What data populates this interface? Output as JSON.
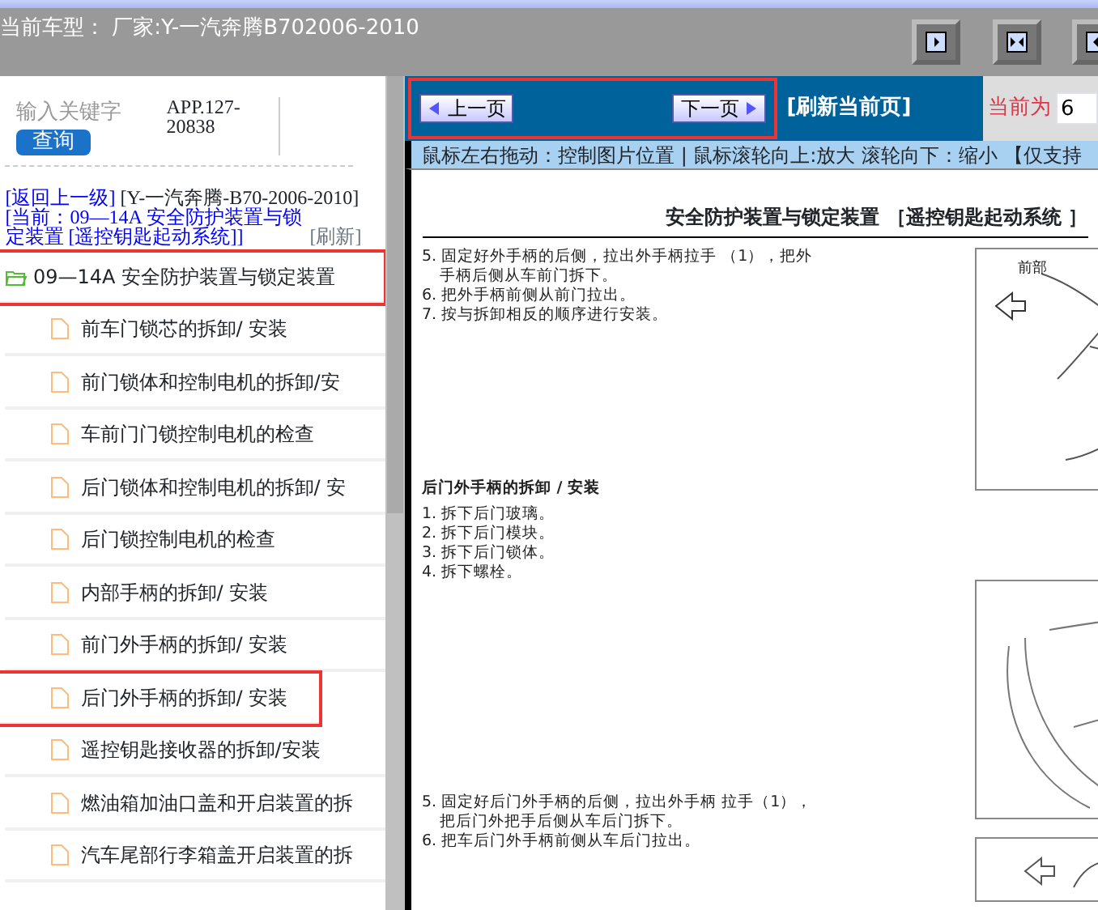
{
  "header": {
    "title": "当前车型： 厂家:Y-一汽奔腾B702006-2010"
  },
  "header_buttons": [
    {
      "kind": "right"
    },
    {
      "kind": "center"
    },
    {
      "kind": "left"
    }
  ],
  "search": {
    "placeholder": "输入关键字",
    "button": "查询",
    "code": "APP.127-20838"
  },
  "breadcrumb": {
    "back": "[返回上一级]",
    "model": "[Y-一汽奔腾-B70-2006-2010]",
    "current": "[当前：09—14A 安全防护装置与锁定装置 [遥控钥匙起动系统]]",
    "refresh": "[刷新]"
  },
  "tree": {
    "label": "09—14A 安全防护装置与锁定装置",
    "highlighted": true,
    "expanded": true,
    "children": [
      {
        "label": "前车门锁芯的拆卸/ 安装",
        "highlighted": false
      },
      {
        "label": "前门锁体和控制电机的拆卸/安",
        "highlighted": false
      },
      {
        "label": "车前门门锁控制电机的检查",
        "highlighted": false
      },
      {
        "label": "后门锁体和控制电机的拆卸/ 安",
        "highlighted": false
      },
      {
        "label": "后门锁控制电机的检查",
        "highlighted": false
      },
      {
        "label": "内部手柄的拆卸/ 安装",
        "highlighted": false
      },
      {
        "label": "前门外手柄的拆卸/ 安装",
        "highlighted": false
      },
      {
        "label": "后门外手柄的拆卸/ 安装",
        "highlighted": true
      },
      {
        "label": "遥控钥匙接收器的拆卸/安装",
        "highlighted": false
      },
      {
        "label": "燃油箱加油口盖和开启装置的拆",
        "highlighted": false
      },
      {
        "label": "汽车尾部行李箱盖开启装置的拆",
        "highlighted": false
      }
    ]
  },
  "toolbar": {
    "prev": "上一页",
    "next": "下一页",
    "highlighted": true,
    "refresh": "[刷新当前页]",
    "page_label": "当前为",
    "page_value": "6"
  },
  "hint": "鼠标左右拖动：控制图片位置 | 鼠标滚轮向上:放大   滚轮向下：缩小 【仅支持",
  "document": {
    "title": "安全防护装置与锁定装置 ［遥控钥匙起动系统 ］",
    "steps_a": [
      "5. 固定好外手柄的后侧，拉出外手柄拉手 （1），把外手柄后侧从车前门拆下。",
      "6. 把外手柄前侧从前门拉出。",
      "7. 按与拆卸相反的顺序进行安装。"
    ],
    "figure_label": "前部",
    "section": "后门外手柄的拆卸 / 安装",
    "steps_b": [
      "1. 拆下后门玻璃。",
      "2. 拆下后门模块。",
      "3. 拆下后门锁体。",
      "4. 拆下螺栓。"
    ],
    "steps_c": [
      "5. 固定好后门外手柄的后侧，拉出外手柄 拉手（1），把后门外把手后侧从车后门拆下。",
      "6. 把车后门外手柄前侧从车后门拉出。"
    ]
  }
}
